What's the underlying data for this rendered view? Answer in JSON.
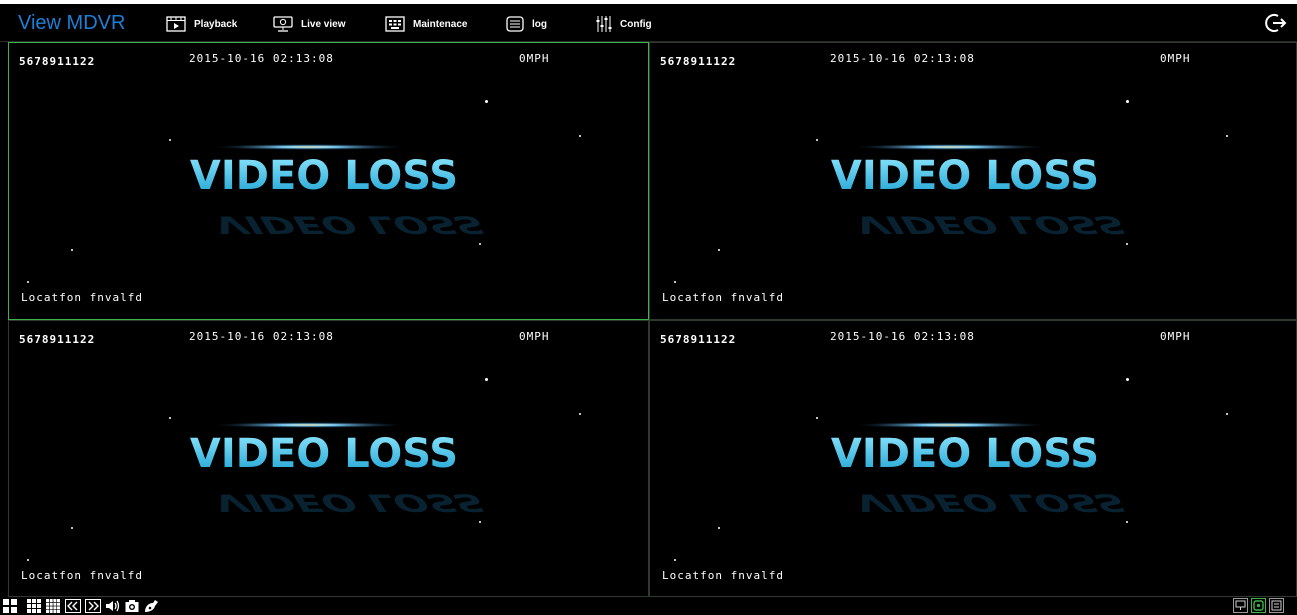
{
  "app": {
    "title": "View MDVR"
  },
  "nav": {
    "items": [
      {
        "label": "Playback",
        "icon": "playback-icon"
      },
      {
        "label": "Live view",
        "icon": "live-view-icon"
      },
      {
        "label": "Maintenace",
        "icon": "maintenance-icon"
      },
      {
        "label": "log",
        "icon": "log-icon"
      },
      {
        "label": "Config",
        "icon": "config-icon"
      }
    ],
    "logout_icon": "logout-icon"
  },
  "channels": [
    {
      "id": "5678911122",
      "datetime": "2015-10-16 02:13:08",
      "speed": "0MPH",
      "location": "Locatfon fnvalfd",
      "status": "VIDEO LOSS",
      "active": true
    },
    {
      "id": "5678911122",
      "datetime": "2015-10-16 02:13:08",
      "speed": "0MPH",
      "location": "Locatfon fnvalfd",
      "status": "VIDEO LOSS",
      "active": false
    },
    {
      "id": "5678911122",
      "datetime": "2015-10-16 02:13:08",
      "speed": "0MPH",
      "location": "Locatfon fnvalfd",
      "status": "VIDEO LOSS",
      "active": false
    },
    {
      "id": "5678911122",
      "datetime": "2015-10-16 02:13:08",
      "speed": "0MPH",
      "location": "Locatfon fnvalfd",
      "status": "VIDEO LOSS",
      "active": false
    }
  ],
  "colors": {
    "brand": "#1e7fd6",
    "active_border": "#3bb54a",
    "video_loss": "#2fc8e8"
  }
}
